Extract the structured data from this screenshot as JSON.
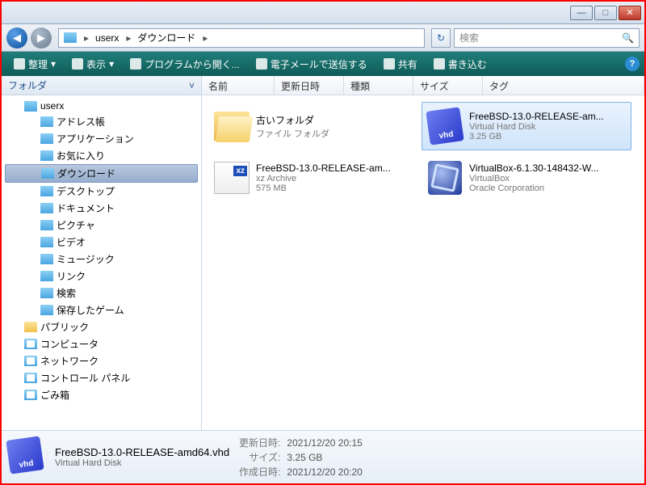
{
  "win": {
    "min": "—",
    "max": "□",
    "close": "✕"
  },
  "nav": {
    "back": "◀",
    "fwd": "▶",
    "refresh": "↻",
    "mag": "🔍"
  },
  "breadcrumb": [
    "userx",
    "ダウンロード"
  ],
  "search": {
    "placeholder": "検索"
  },
  "toolbar": {
    "organize": "整理",
    "view": "表示",
    "openwith": "プログラムから開く...",
    "email": "電子メールで送信する",
    "share": "共有",
    "burn": "書き込む",
    "help": "?"
  },
  "sidebar": {
    "header": "フォルダ",
    "root": "userx",
    "items": [
      "アドレス帳",
      "アプリケーション",
      "お気に入り",
      "ダウンロード",
      "デスクトップ",
      "ドキュメント",
      "ピクチャ",
      "ビデオ",
      "ミュージック",
      "リンク",
      "検索",
      "保存したゲーム"
    ],
    "extra": [
      "パブリック",
      "コンピュータ",
      "ネットワーク",
      "コントロール パネル",
      "ごみ箱"
    ]
  },
  "columns": {
    "name": "名前",
    "date": "更新日時",
    "type": "種類",
    "size": "サイズ",
    "tag": "タグ"
  },
  "files": [
    {
      "id": "old",
      "name": "古いフォルダ",
      "l2": "ファイル フォルダ",
      "l3": ""
    },
    {
      "id": "vhd",
      "name": "FreeBSD-13.0-RELEASE-am...",
      "l2": "Virtual Hard Disk",
      "l3": "3.25 GB"
    },
    {
      "id": "xz",
      "name": "FreeBSD-13.0-RELEASE-am...",
      "l2": "xz Archive",
      "l3": "575 MB"
    },
    {
      "id": "vb",
      "name": "VirtualBox-6.1.30-148432-W...",
      "l2": "VirtualBox",
      "l3": "Oracle Corporation"
    }
  ],
  "details": {
    "name": "FreeBSD-13.0-RELEASE-amd64.vhd",
    "type": "Virtual Hard Disk",
    "m1k": "更新日時:",
    "m1v": "2021/12/20 20:15",
    "m2k": "サイズ:",
    "m2v": "3.25 GB",
    "m3k": "作成日時:",
    "m3v": "2021/12/20 20:20"
  }
}
